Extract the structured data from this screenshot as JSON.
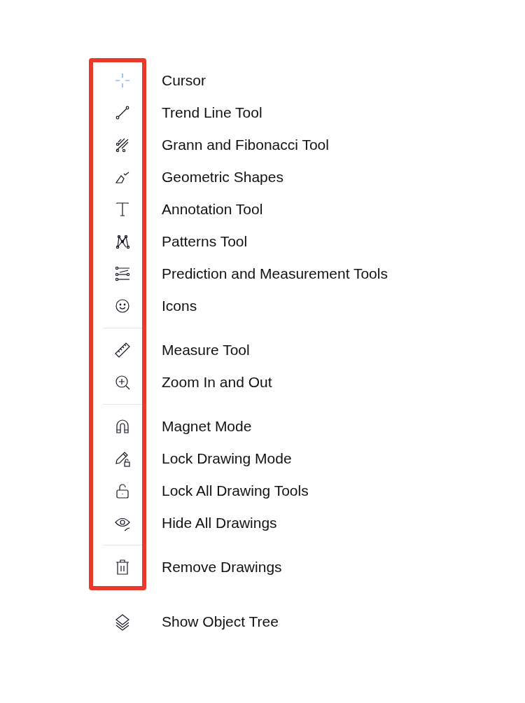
{
  "sections": [
    {
      "items": [
        {
          "label": "Cursor",
          "selected": true
        },
        {
          "label": "Trend Line Tool",
          "selected": false
        },
        {
          "label": "Grann and Fibonacci Tool",
          "selected": false
        },
        {
          "label": "Geometric Shapes",
          "selected": false
        },
        {
          "label": "Annotation Tool",
          "selected": false
        },
        {
          "label": "Patterns Tool",
          "selected": false
        },
        {
          "label": "Prediction and Measurement Tools",
          "selected": false
        },
        {
          "label": "Icons",
          "selected": false
        }
      ]
    },
    {
      "items": [
        {
          "label": "Measure Tool",
          "selected": false
        },
        {
          "label": "Zoom In and Out",
          "selected": false
        }
      ]
    },
    {
      "items": [
        {
          "label": "Magnet Mode",
          "selected": false
        },
        {
          "label": "Lock Drawing Mode",
          "selected": false
        },
        {
          "label": "Lock All Drawing Tools",
          "selected": false
        },
        {
          "label": "Hide All Drawings",
          "selected": false
        }
      ]
    },
    {
      "items": [
        {
          "label": "Remove Drawings",
          "selected": false
        }
      ]
    }
  ],
  "footer": {
    "label": "Show Object Tree"
  }
}
